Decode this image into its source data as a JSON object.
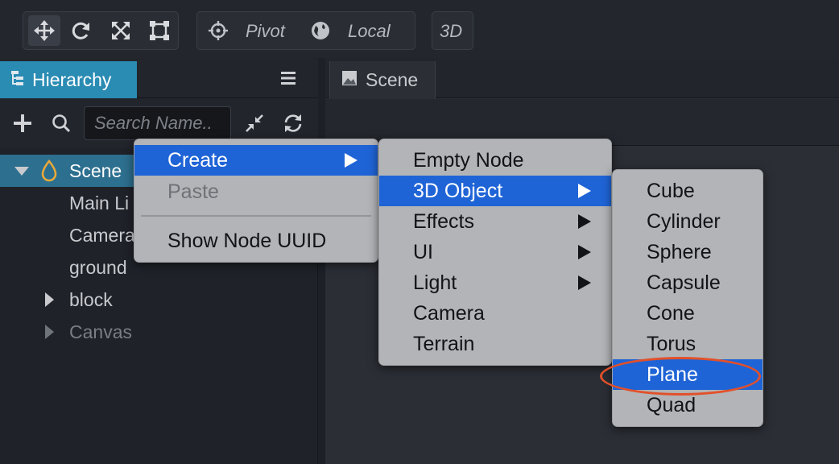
{
  "toolbar": {
    "tools": [
      "move-tool-icon",
      "rotate-tool-icon",
      "scale-tool-icon",
      "rect-tool-icon"
    ],
    "pivot_label": "Pivot",
    "local_label": "Local",
    "mode_3d_label": "3D"
  },
  "hierarchy": {
    "tab_label": "Hierarchy",
    "search_placeholder": "Search Name..",
    "tree": [
      {
        "label": "Scene",
        "selected": true
      },
      {
        "label": "Main Li"
      },
      {
        "label": "Camera"
      },
      {
        "label": "ground"
      },
      {
        "label": "block",
        "expandable": true
      },
      {
        "label": "Canvas",
        "expandable": true,
        "dimmed": true
      }
    ]
  },
  "scene": {
    "tab_label": "Scene"
  },
  "context_menu": {
    "items": [
      {
        "label": "Create",
        "highlighted": true,
        "submenu": true
      },
      {
        "label": "Paste",
        "disabled": true
      },
      {
        "label": "Show Node UUID"
      }
    ]
  },
  "create_menu": {
    "items": [
      {
        "label": "Empty Node"
      },
      {
        "label": "3D Object",
        "highlighted": true,
        "submenu": true
      },
      {
        "label": "Effects",
        "submenu": true
      },
      {
        "label": "UI",
        "submenu": true
      },
      {
        "label": "Light",
        "submenu": true
      },
      {
        "label": "Camera"
      },
      {
        "label": "Terrain"
      }
    ]
  },
  "object_menu": {
    "items": [
      {
        "label": "Cube"
      },
      {
        "label": "Cylinder"
      },
      {
        "label": "Sphere"
      },
      {
        "label": "Capsule"
      },
      {
        "label": "Cone"
      },
      {
        "label": "Torus"
      },
      {
        "label": "Plane",
        "highlighted": true
      },
      {
        "label": "Quad"
      }
    ]
  },
  "colors": {
    "highlight": "#1f64d6",
    "annotation_circle": "#e2502a",
    "hierarchy_tab": "#2a8bb3"
  }
}
